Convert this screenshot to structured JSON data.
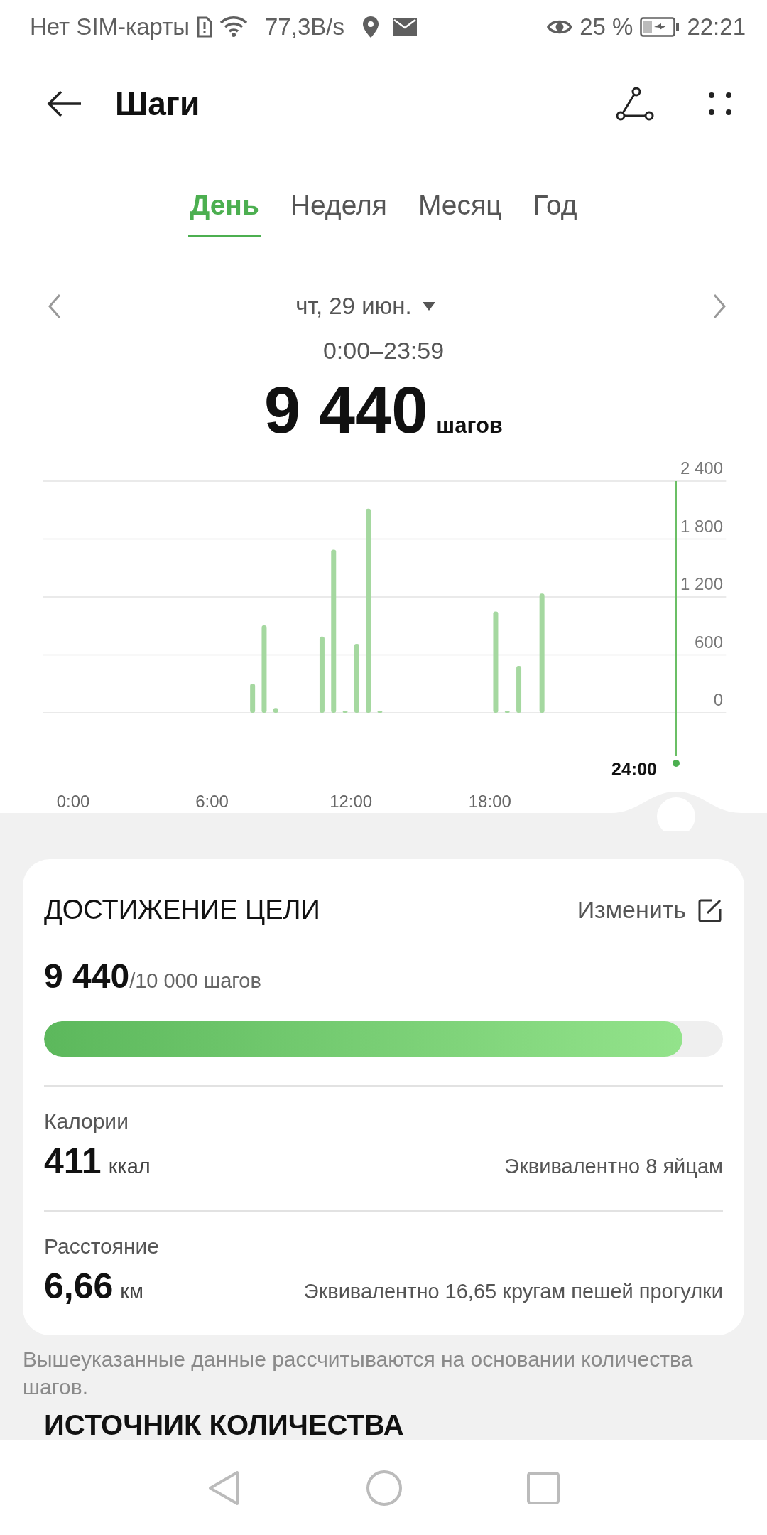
{
  "status_bar": {
    "carrier": "Нет SIM-карты",
    "speed": "77,3B/s",
    "battery": "25 %",
    "time": "22:21"
  },
  "header": {
    "title": "Шаги"
  },
  "tabs": [
    {
      "label": "День",
      "selected": true
    },
    {
      "label": "Неделя",
      "selected": false
    },
    {
      "label": "Месяц",
      "selected": false
    },
    {
      "label": "Год",
      "selected": false
    }
  ],
  "date": {
    "label": "чт, 29 июн."
  },
  "summary": {
    "range": "0:00–23:59",
    "steps": "9 440",
    "unit": "шагов"
  },
  "chart_data": {
    "type": "bar",
    "x": [
      7.75,
      8.25,
      8.75,
      10.75,
      11.25,
      11.75,
      12.25,
      12.75,
      13.25,
      18.25,
      18.75,
      19.25,
      20.25
    ],
    "values": [
      300,
      905,
      50,
      790,
      1690,
      20,
      715,
      2115,
      20,
      1050,
      20,
      485,
      1235
    ],
    "xlim": [
      -1.3,
      28.2
    ],
    "ylim": [
      0,
      2400
    ],
    "grid": true,
    "xticks": [
      {
        "value": 0,
        "label": "0:00"
      },
      {
        "value": 6,
        "label": "6:00"
      },
      {
        "value": 12,
        "label": "12:00"
      },
      {
        "value": 18,
        "label": "18:00"
      }
    ],
    "yticks": [
      {
        "value": 0,
        "label": "0"
      },
      {
        "value": 600,
        "label": "600"
      },
      {
        "value": 1200,
        "label": "1 200"
      },
      {
        "value": 1800,
        "label": "1 800"
      },
      {
        "value": 2400,
        "label": "2 400"
      }
    ]
  },
  "chart_cursor": {
    "time": "24:00"
  },
  "goal": {
    "title": "ДОСТИЖЕНИЕ ЦЕЛИ",
    "edit": "Изменить",
    "value": "9 440",
    "target": "/10 000 шагов",
    "level": 0.94
  },
  "metrics": [
    {
      "label": "Калории",
      "value": "411",
      "unit": "ккал",
      "note": "Эквивалентно 8 яйцам"
    },
    {
      "label": "Расстояние",
      "value": "6,66",
      "unit": "км",
      "note": "Эквивалентно 16,65 кругам пешей прогулки"
    }
  ],
  "footnote": "Вышеуказанные данные рассчитываются на основании количества шагов.",
  "next_section": {
    "title": "ИСТОЧНИК КОЛИЧЕСТВА"
  }
}
